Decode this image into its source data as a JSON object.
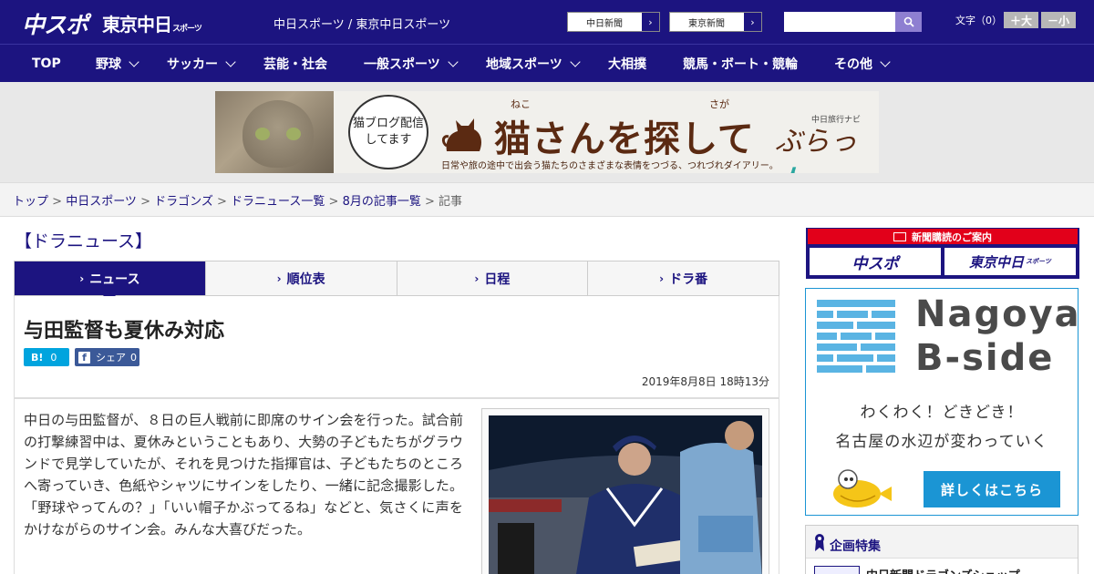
{
  "header": {
    "logo_chuspo": "中スポ",
    "logo_tokyo": "東京中日",
    "logo_tokyo_small": "スポーツ",
    "site_names": "中日スポーツ / 東京中日スポーツ",
    "newspaper_links": [
      {
        "label": "中日新聞"
      },
      {
        "label": "東京新聞"
      }
    ],
    "search": {
      "value": "",
      "placeholder": ""
    },
    "font_size_label": "文字（0）",
    "font_plus": "＋大",
    "font_minus": "－小"
  },
  "nav": {
    "items": [
      {
        "label": "TOP"
      },
      {
        "label": "野球"
      },
      {
        "label": "サッカー"
      },
      {
        "label": "芸能・社会"
      },
      {
        "label": "一般スポーツ"
      },
      {
        "label": "地域スポーツ"
      },
      {
        "label": "大相撲"
      },
      {
        "label": "競馬・ボート・競輪"
      },
      {
        "label": "その他"
      }
    ]
  },
  "banner": {
    "bubble_text": "猫ブログ配信してます",
    "ruby_neko": "ねこ",
    "ruby_saga": "さが",
    "title": "猫さんを探して",
    "subtitle": "日常や旅の途中で出会う猫たちのさまざまな表情をつづる、つれづれダイアリー。",
    "navi_label": "中日旅行ナビ",
    "navi_name_a": "ぶらっ",
    "navi_name_b": "人"
  },
  "breadcrumb": {
    "items": [
      "トップ",
      "中日スポーツ",
      "ドラゴンズ",
      "ドラニュース一覧",
      "8月の記事一覧"
    ],
    "current": "記事",
    "separator": " > "
  },
  "main": {
    "section_title": "【ドラニュース】",
    "tabs": [
      {
        "label": "ニュース",
        "active": true
      },
      {
        "label": "順位表",
        "active": false
      },
      {
        "label": "日程",
        "active": false
      },
      {
        "label": "ドラ番",
        "active": false
      }
    ],
    "tab_arrow": "›",
    "article": {
      "title": "与田監督も夏休み対応",
      "hatena_label": "B!",
      "hatena_count": "0",
      "fb_label": "シェア",
      "fb_count": "0",
      "date": "2019年8月8日 18時13分",
      "body": "中日の与田監督が、８日の巨人戦前に即席のサイン会を行った。試合前の打撃練習中は、夏休みということもあり、大勢の子どもたちがグラウンドで見学していたが、それを見つけた指揮官は、子どもたちのところへ寄っていき、色紙やシャツにサインをしたり、一緒に記念撮影した。「野球やってんの？」「いい帽子かぶってるね」などと、気さくに声をかけながらのサイン会。みんな大喜びだった。"
    }
  },
  "sidebar": {
    "subscription": {
      "header": "新聞購読のご案内",
      "logo_chuspo": "中スポ",
      "logo_tokyo": "東京中日",
      "logo_tokyo_small": "スポーツ"
    },
    "bside": {
      "title_line1": "Nagoya",
      "title_line2": "B-side",
      "line1": "わくわく！どきどき！",
      "line2": "名古屋の水辺が変わっていく",
      "button": "詳しくはこちら"
    },
    "feature": {
      "title": "企画特集",
      "item": "中日新聞ドラゴンズショップ"
    }
  },
  "colors": {
    "brand_navy": "#1c1480",
    "accent_red": "#e2001a",
    "bside_blue": "#1b95d4",
    "hatena_blue": "#00a4de",
    "facebook_blue": "#3b5998"
  }
}
